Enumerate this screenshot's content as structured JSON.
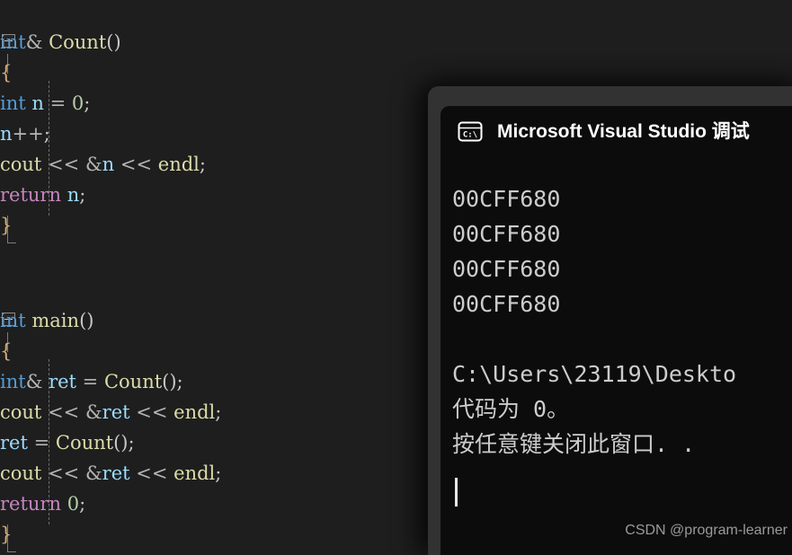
{
  "editor": {
    "background": "#1e1e1e",
    "blocks": [
      {
        "name": "count-function",
        "lines": [
          {
            "segments": [
              {
                "t": "int",
                "c": "kw"
              },
              {
                "t": "& ",
                "c": "op"
              },
              {
                "t": "Count",
                "c": "fn"
              },
              {
                "t": "()",
                "c": "punc"
              }
            ]
          },
          {
            "segments": [
              {
                "t": "{",
                "c": "brace"
              }
            ]
          },
          {
            "segments": [
              {
                "t": "int",
                "c": "kw"
              },
              {
                "t": " ",
                "c": "plain"
              },
              {
                "t": "n",
                "c": "var"
              },
              {
                "t": " ",
                "c": "plain"
              },
              {
                "t": "=",
                "c": "op"
              },
              {
                "t": " ",
                "c": "plain"
              },
              {
                "t": "0",
                "c": "num"
              },
              {
                "t": ";",
                "c": "punc"
              }
            ]
          },
          {
            "segments": [
              {
                "t": "n",
                "c": "var"
              },
              {
                "t": "++",
                "c": "op"
              },
              {
                "t": ";",
                "c": "punc"
              }
            ]
          },
          {
            "segments": [
              {
                "t": "cout",
                "c": "fn"
              },
              {
                "t": " ",
                "c": "plain"
              },
              {
                "t": "<<",
                "c": "op"
              },
              {
                "t": " ",
                "c": "plain"
              },
              {
                "t": "&",
                "c": "op"
              },
              {
                "t": "n",
                "c": "var"
              },
              {
                "t": " ",
                "c": "plain"
              },
              {
                "t": "<<",
                "c": "op"
              },
              {
                "t": " ",
                "c": "plain"
              },
              {
                "t": "endl",
                "c": "fn"
              },
              {
                "t": ";",
                "c": "punc"
              }
            ]
          },
          {
            "segments": [
              {
                "t": "return",
                "c": "ctl"
              },
              {
                "t": " ",
                "c": "plain"
              },
              {
                "t": "n",
                "c": "var"
              },
              {
                "t": ";",
                "c": "punc"
              }
            ]
          },
          {
            "segments": [
              {
                "t": "}",
                "c": "brace"
              }
            ]
          }
        ]
      },
      {
        "name": "main-function",
        "lines": [
          {
            "segments": [
              {
                "t": "int",
                "c": "kw"
              },
              {
                "t": " ",
                "c": "plain"
              },
              {
                "t": "main",
                "c": "fn"
              },
              {
                "t": "()",
                "c": "punc"
              }
            ]
          },
          {
            "segments": [
              {
                "t": "{",
                "c": "brace"
              }
            ]
          },
          {
            "segments": [
              {
                "t": "int",
                "c": "kw"
              },
              {
                "t": "& ",
                "c": "op"
              },
              {
                "t": "ret",
                "c": "var"
              },
              {
                "t": " ",
                "c": "plain"
              },
              {
                "t": "=",
                "c": "op"
              },
              {
                "t": " ",
                "c": "plain"
              },
              {
                "t": "Count",
                "c": "fn"
              },
              {
                "t": "()",
                "c": "punc"
              },
              {
                "t": ";",
                "c": "punc"
              }
            ]
          },
          {
            "segments": [
              {
                "t": "cout",
                "c": "fn"
              },
              {
                "t": " ",
                "c": "plain"
              },
              {
                "t": "<<",
                "c": "op"
              },
              {
                "t": " ",
                "c": "plain"
              },
              {
                "t": "&",
                "c": "op"
              },
              {
                "t": "ret",
                "c": "var"
              },
              {
                "t": " ",
                "c": "plain"
              },
              {
                "t": "<<",
                "c": "op"
              },
              {
                "t": " ",
                "c": "plain"
              },
              {
                "t": "endl",
                "c": "fn"
              },
              {
                "t": ";",
                "c": "punc"
              }
            ]
          },
          {
            "segments": [
              {
                "t": "ret",
                "c": "var"
              },
              {
                "t": " ",
                "c": "plain"
              },
              {
                "t": "=",
                "c": "op"
              },
              {
                "t": " ",
                "c": "plain"
              },
              {
                "t": "Count",
                "c": "fn"
              },
              {
                "t": "()",
                "c": "punc"
              },
              {
                "t": ";",
                "c": "punc"
              }
            ]
          },
          {
            "segments": [
              {
                "t": "cout",
                "c": "fn"
              },
              {
                "t": " ",
                "c": "plain"
              },
              {
                "t": "<<",
                "c": "op"
              },
              {
                "t": " ",
                "c": "plain"
              },
              {
                "t": "&",
                "c": "op"
              },
              {
                "t": "ret",
                "c": "var"
              },
              {
                "t": " ",
                "c": "plain"
              },
              {
                "t": "<<",
                "c": "op"
              },
              {
                "t": " ",
                "c": "plain"
              },
              {
                "t": "endl",
                "c": "fn"
              },
              {
                "t": ";",
                "c": "punc"
              }
            ]
          },
          {
            "segments": [
              {
                "t": "return",
                "c": "ctl"
              },
              {
                "t": " ",
                "c": "plain"
              },
              {
                "t": "0",
                "c": "num"
              },
              {
                "t": ";",
                "c": "punc"
              }
            ]
          },
          {
            "segments": [
              {
                "t": "}",
                "c": "brace"
              }
            ]
          }
        ]
      }
    ]
  },
  "console": {
    "icon": "cmd-console-icon",
    "title": "Microsoft Visual Studio 调试",
    "background": "#0c0c0c",
    "frame_color": "#323232",
    "output": [
      "00CFF680",
      "00CFF680",
      "00CFF680",
      "00CFF680",
      "",
      "C:\\Users\\23119\\Deskto",
      "代码为 0。",
      "按任意键关闭此窗口. ."
    ]
  },
  "watermark": {
    "text": "CSDN @program-learner"
  }
}
